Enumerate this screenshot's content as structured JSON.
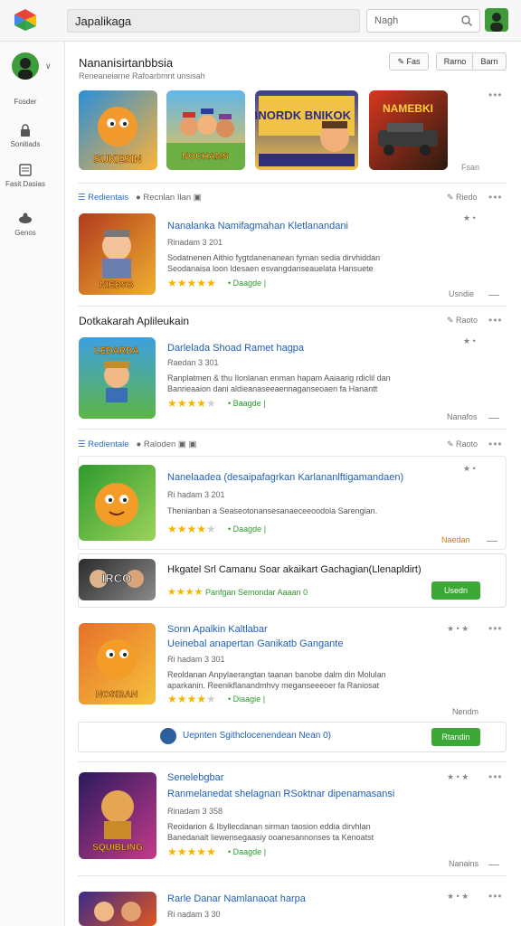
{
  "header": {
    "search_value": "Japalikaga",
    "search_small_placeholder": "Nagh"
  },
  "sidebar": {
    "items": [
      {
        "label": "Fosder",
        "icon": "home-icon"
      },
      {
        "label": "Sonitiads",
        "icon": "lock-icon"
      },
      {
        "label": "Fasit Dasias",
        "icon": "document-icon"
      },
      {
        "label": "Genos",
        "icon": "gamepad-icon"
      }
    ]
  },
  "featured": {
    "title": "Nananisirtanbbsia",
    "subtitle": "Reneaneiarne  Rafoarbmnt unsisah",
    "button_left": "Fas",
    "button_mid": "Rarno",
    "button_right": "Barn",
    "more_label": "Fsan",
    "tiles": [
      {
        "caption": "SUKESIN",
        "bg1": "#2a8fd8",
        "bg2": "#ffb236"
      },
      {
        "caption": "NOCHAMS",
        "bg1": "#5fb7ea",
        "bg2": "#f5c246"
      },
      {
        "caption": "BNORDK BNIKOK",
        "bg1": "#3a3f8c",
        "bg2": "#f0c246"
      },
      {
        "caption": "NAMEBKI",
        "bg1": "#d7371f",
        "bg2": "#2b1a10"
      }
    ]
  },
  "section1": {
    "tag": "Redientais",
    "right_text": "Recnlan Ilan",
    "more_label": "Riedo"
  },
  "apps": [
    {
      "title": "Nanalanka Namifagmahan Kletlanandani",
      "meta": "Rinadam 3  201",
      "desc1": "Sodatnenen Aithio fygtdanenanean fyman sedia dirvhiddan",
      "desc2": "Seodanaisa  loon ldesaen esvangdanseauelata Hansuete",
      "rating": "4",
      "badge": "Daagde",
      "corner": "Usndie",
      "caption": "NIEBSB"
    },
    {
      "title": "Darlelada Shoad Ramet hagpa",
      "meta": "Raedan 3  301",
      "desc1": "Ranplatmen & thu Ilonlanan enman hapam Aaiaarig rdiclil dan",
      "desc2": "Banrieaaion dani aldieanaseeaennaganseoaen fa Hanantt",
      "rating": "4",
      "badge": "Baagde",
      "corner": "Nanafos",
      "caption": "LEDARDA"
    },
    {
      "title": "Nanelaadea (desaipafagrkan Karlananlftigamandaen)",
      "meta": "Ri hadam 3  201",
      "desc1": "Thenianban a  Seaseotonansesanaeceeoodola Sarengian.",
      "rating": "4",
      "badge": "Daagde",
      "corner": "Naedan"
    },
    {
      "title": "Sonn Apalkin Kaltlabar",
      "title2": "Ueinebal anapertan Ganikatb Gangante",
      "meta": "Ri hadam 3  301",
      "desc1": "Reoldanan Anpylaerangtan taanan banobe dalm din Molulan",
      "desc2": "aparkanin. Reenikflanandmhvy meganseeeoer fa Raniosat",
      "rating": "4",
      "badge": "Diaagie",
      "corner": "Nendm",
      "caption": "NOSIBAN"
    },
    {
      "title": "Senelebgbar",
      "title2": "Ranmelanedat shelagnan RSoktnar dipenamasansi",
      "meta": "Rinadam 3  358",
      "desc1": "Reoidarion & Ibyllecdanan sirman taosion eddia dirvhlan",
      "desc2": "Banedanalt  liewensegaasiy ooanesannonses ta Kenoatst",
      "rating": "5",
      "badge": "Daagde",
      "corner": "Nanains",
      "caption": "SQUIBLING"
    },
    {
      "title": "Rarle Danar Namlanaoat harpa",
      "meta": "Ri nadam 3  30"
    }
  ],
  "section2": {
    "heading": "Dotkakarah Aplileukain",
    "right_text": "Raoto"
  },
  "section3": {
    "tag": "Redientale",
    "right_text": "Raloden",
    "more_label": "Raoto"
  },
  "promo1": {
    "title": "Hkgatel Srl Camanu Soar akaikart Gachagian(Llenapldirt)",
    "line": "Panfgan Semondar Aaaan 0",
    "button": "Usedn",
    "caption": "IRCO"
  },
  "promo2": {
    "line": "Uepnten Sgithclocenendean Nean 0)",
    "button": "Rtandin"
  },
  "colors": {
    "link": "#1f5fb4",
    "accent_green": "#3ca835",
    "star": "#f4b400"
  }
}
